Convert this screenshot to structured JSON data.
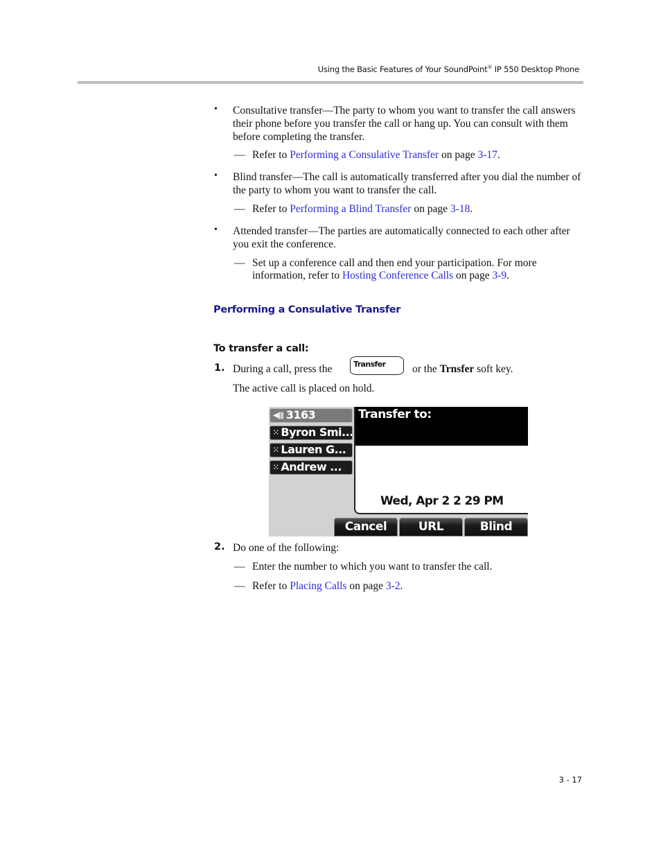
{
  "header": {
    "running_title_pre": "Using the Basic Features of Your SoundPoint",
    "registered_mark": "®",
    "running_title_post": " IP 550 Desktop Phone"
  },
  "bullets": [
    {
      "symbol": "•",
      "text": "Consultative transfer—The party to whom you want to transfer the call answers their phone before you transfer the call or hang up. You can consult with them before completing the transfer.",
      "sub": {
        "dash": "—",
        "pre": "Refer to ",
        "link": "Performing a Consulative Transfer",
        "mid": " on page ",
        "page_link": "3-17",
        "post": "."
      }
    },
    {
      "symbol": "•",
      "text": "Blind transfer—The call is automatically transferred after you dial the number of the party to whom you want to transfer the call.",
      "sub": {
        "dash": "—",
        "pre": "Refer to ",
        "link": "Performing a Blind Transfer",
        "mid": " on page ",
        "page_link": "3-18",
        "post": "."
      }
    },
    {
      "symbol": "•",
      "text": "Attended transfer—The parties are automatically connected to each other after you exit the conference.",
      "sub": {
        "dash": "—",
        "pre": "Set up a conference call and then end your participation. For more information, refer to ",
        "link": "Hosting Conference Calls",
        "mid": " on page ",
        "page_link": "3-9",
        "post": "."
      }
    }
  ],
  "section_title": "Performing a Consulative Transfer",
  "procedure_title": "To transfer a call:",
  "steps": [
    {
      "num": "1.",
      "pre": "During a call, press the",
      "hardkey_label": "Transfer",
      "mid": "or the ",
      "softkey_bold": "Trnsfer",
      "post": " soft key.",
      "result": "The active call is placed on hold."
    },
    {
      "num": "2.",
      "text": "Do one of the following:",
      "subs": [
        {
          "dash": "—",
          "text": "Enter the number to which you want to transfer the call."
        },
        {
          "dash": "—",
          "pre": "Refer to ",
          "link": "Placing Calls",
          "mid": " on page ",
          "page_link": "3-2",
          "post": "."
        }
      ]
    }
  ],
  "phone_screen": {
    "line_keys": [
      {
        "icon": "◀‖‖",
        "label": "3163",
        "active": true
      },
      {
        "icon": "⁙",
        "label": "Byron Smi..."
      },
      {
        "icon": "⁙",
        "label": "Lauren G..."
      },
      {
        "icon": "⁙",
        "label": "Andrew ..."
      }
    ],
    "title": "Transfer to:",
    "datetime": "Wed, Apr 2  2 29 PM",
    "softkeys": [
      "Cancel",
      "URL",
      "Blind"
    ]
  },
  "footer": {
    "page_number": "3 - 17"
  },
  "colors": {
    "link": "#2b2bd6",
    "section_title": "#1a1a8c",
    "rule": "#bdbdbd"
  }
}
